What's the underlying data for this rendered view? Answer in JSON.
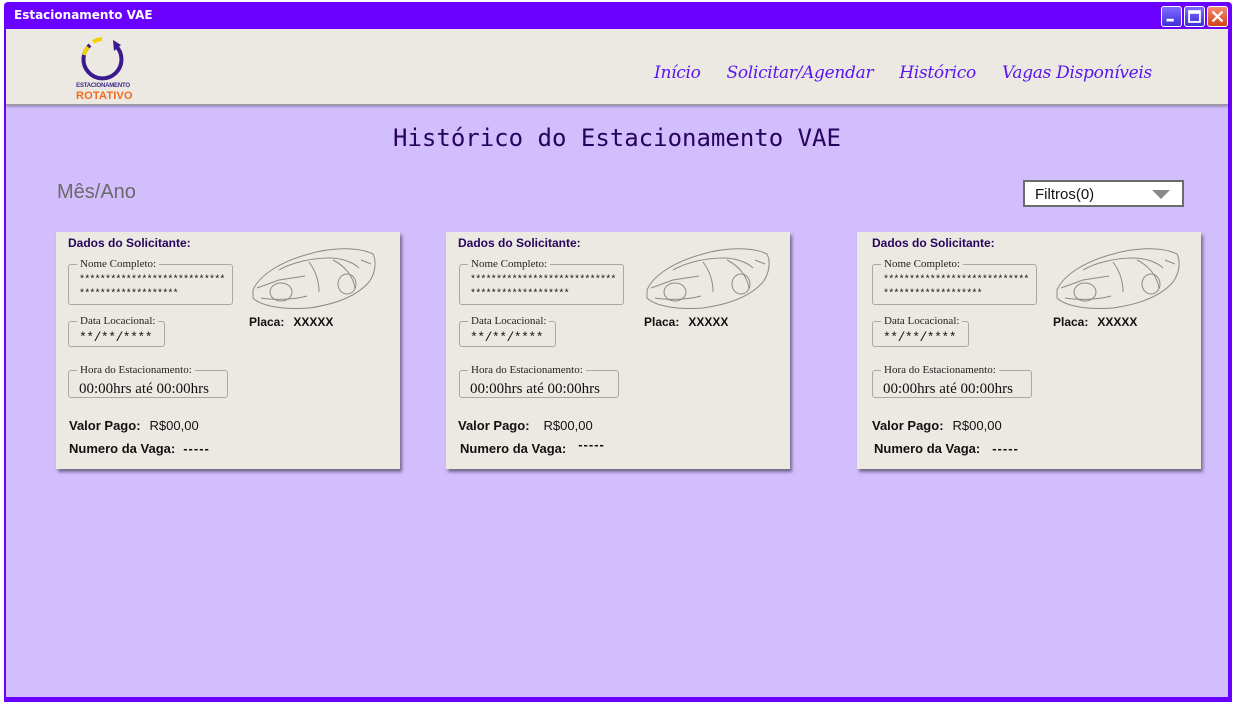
{
  "window": {
    "title": "Estacionamento VAE",
    "buttons": [
      "minimize",
      "maximize",
      "close"
    ]
  },
  "logo": {
    "line1": "ESTACIONAMENTO",
    "line2": "ROTATIVO"
  },
  "nav": {
    "items": [
      {
        "label": "Início"
      },
      {
        "label": "Solicitar/Agendar"
      },
      {
        "label": "Histórico"
      },
      {
        "label": "Vagas Disponíveis"
      }
    ]
  },
  "page": {
    "title": "Histórico do Estacionamento VAE",
    "month_label": "Mês/Ano",
    "filter_label": "Filtros(0)"
  },
  "colors": {
    "window_frame": "#6a00ff",
    "background": "#d2bdfd",
    "navbar": "#ece9e3",
    "card": "#ece9e3",
    "nav_link": "#5a16ee",
    "title_text": "#26035c"
  },
  "cards": [
    {
      "header": "Dados do Solicitante:",
      "name_label": "Nome Completo:",
      "name_line1": "****************************",
      "name_line2": "*******************",
      "date_label": "Data Locacional:",
      "date_value": "**/**/****",
      "hour_label": "Hora do Estacionamento:",
      "hour_value": "00:00hrs  até  00:00hrs",
      "plate_label": "Placa:",
      "plate_value": "XXXXX",
      "paid_label": "Valor Pago:",
      "paid_value": "R$00,00",
      "spot_label": "Numero da Vaga:",
      "spot_value": "-----"
    },
    {
      "header": "Dados do Solicitante:",
      "name_label": "Nome Completo:",
      "name_line1": "****************************",
      "name_line2": "*******************",
      "date_label": "Data Locacional:",
      "date_value": "**/**/****",
      "hour_label": "Hora do Estacionamento:",
      "hour_value": "00:00hrs  até  00:00hrs",
      "plate_label": "Placa:",
      "plate_value": "XXXXX",
      "paid_label": "Valor Pago:",
      "paid_value": "R$00,00",
      "spot_label": "Numero da Vaga:",
      "spot_value": "-----"
    },
    {
      "header": "Dados do Solicitante:",
      "name_label": "Nome Completo:",
      "name_line1": "****************************",
      "name_line2": "*******************",
      "date_label": "Data Locacional:",
      "date_value": "**/**/****",
      "hour_label": "Hora do Estacionamento:",
      "hour_value": "00:00hrs  até  00:00hrs",
      "plate_label": "Placa:",
      "plate_value": "XXXXX",
      "paid_label": "Valor Pago:",
      "paid_value": "R$00,00",
      "spot_label": "Numero da Vaga:",
      "spot_value": "-----"
    }
  ]
}
